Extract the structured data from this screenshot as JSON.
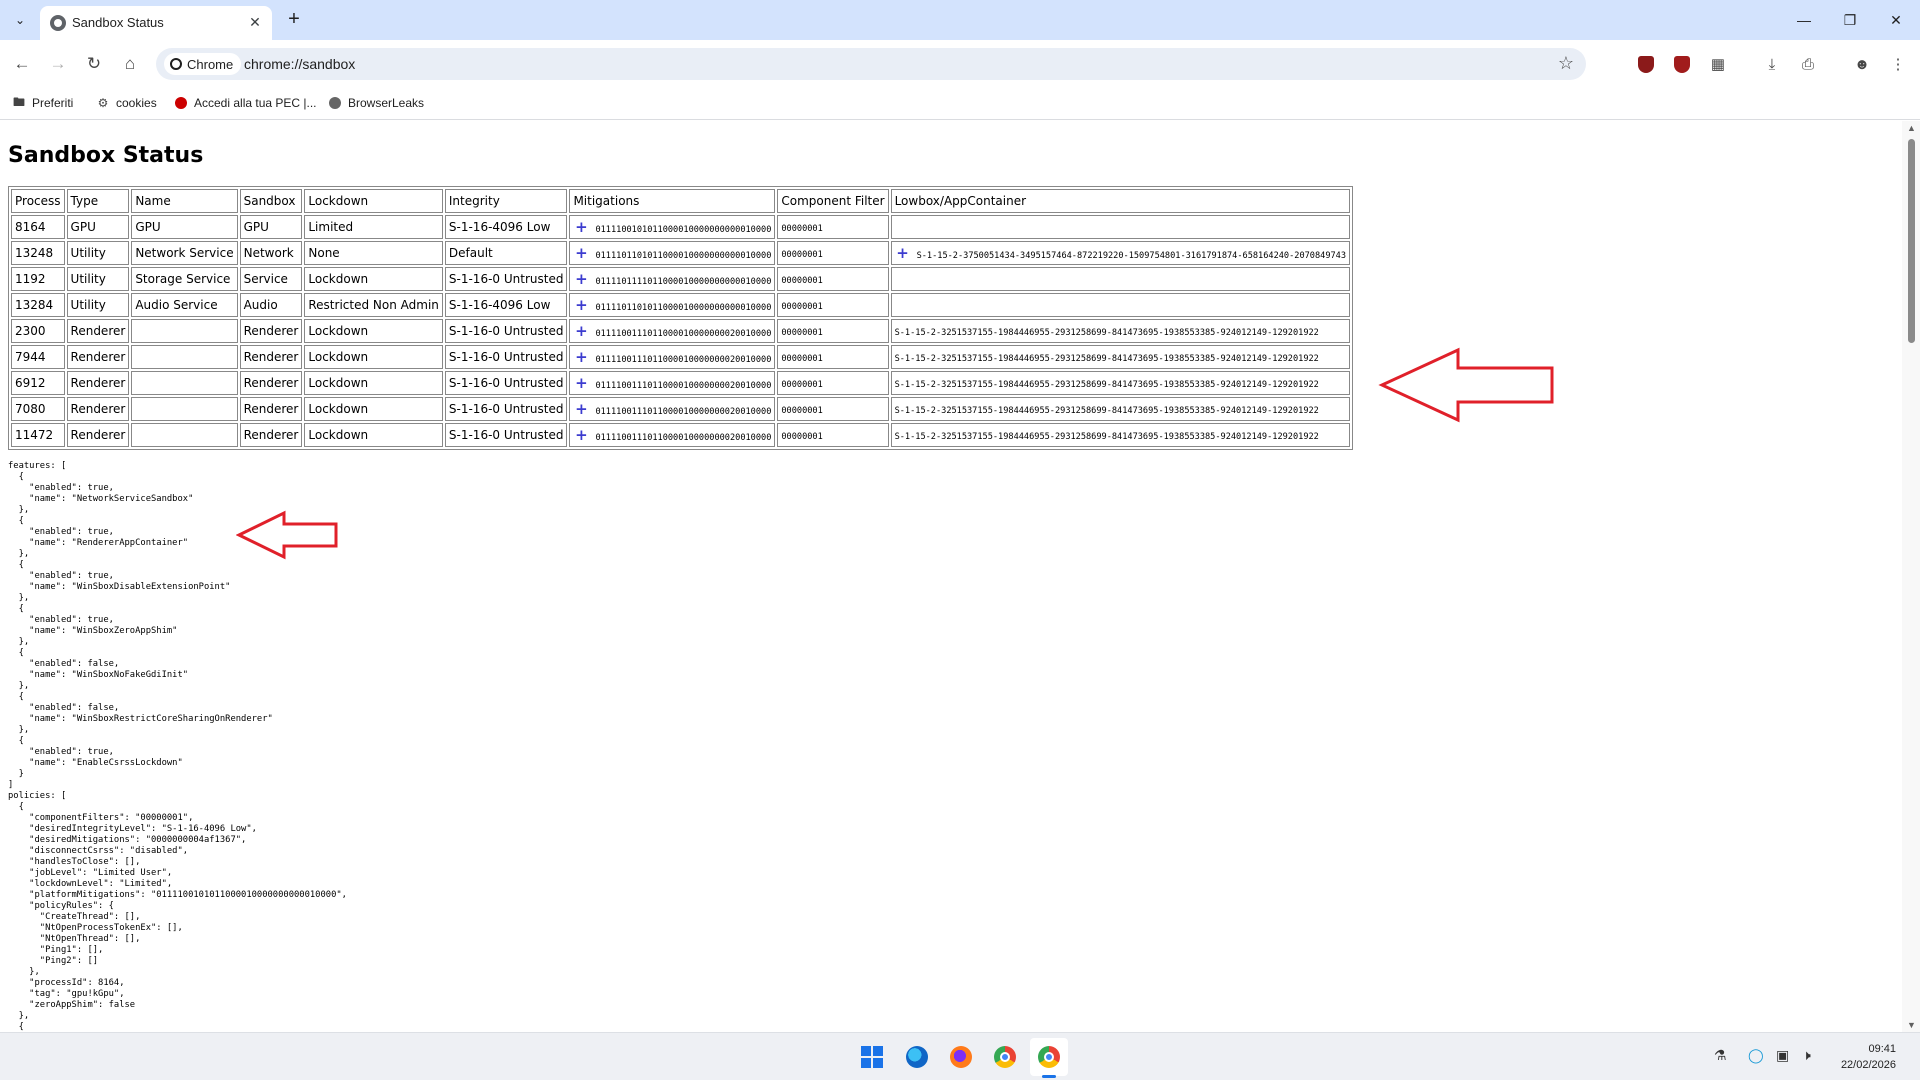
{
  "browser": {
    "tab_title": "Sandbox Status",
    "omnibox_chip": "Chrome",
    "url": "chrome://sandbox",
    "bookmarks": [
      "Preferiti",
      "cookies",
      "Accedi alla tua PEC |...",
      "BrowserLeaks"
    ]
  },
  "page": {
    "title": "Sandbox Status",
    "table": {
      "headers": [
        "Process",
        "Type",
        "Name",
        "Sandbox",
        "Lockdown",
        "Integrity",
        "Mitigations",
        "Component Filter",
        "Lowbox/AppContainer"
      ],
      "rows": [
        [
          "8164",
          "GPU",
          "GPU",
          "GPU",
          "Limited",
          "S-1-16-4096 Low",
          "0111100101011000010000000000010000",
          "00000001",
          ""
        ],
        [
          "13248",
          "Utility",
          "Network Service",
          "Network",
          "None",
          "Default",
          "0111101101011000010000000000010000",
          "00000001",
          "S-1-15-2-3750051434-3495157464-872219220-1509754801-3161791874-658164240-2070849743"
        ],
        [
          "1192",
          "Utility",
          "Storage Service",
          "Service",
          "Lockdown",
          "S-1-16-0 Untrusted",
          "0111101111011000010000000000010000",
          "00000001",
          ""
        ],
        [
          "13284",
          "Utility",
          "Audio Service",
          "Audio",
          "Restricted Non Admin",
          "S-1-16-4096 Low",
          "0111101101011000010000000000010000",
          "00000001",
          ""
        ],
        [
          "2300",
          "Renderer",
          "",
          "Renderer",
          "Lockdown",
          "S-1-16-0 Untrusted",
          "0111100111011000010000000020010000",
          "00000001",
          "S-1-15-2-3251537155-1984446955-2931258699-841473695-1938553385-924012149-129201922"
        ],
        [
          "7944",
          "Renderer",
          "",
          "Renderer",
          "Lockdown",
          "S-1-16-0 Untrusted",
          "0111100111011000010000000020010000",
          "00000001",
          "S-1-15-2-3251537155-1984446955-2931258699-841473695-1938553385-924012149-129201922"
        ],
        [
          "6912",
          "Renderer",
          "",
          "Renderer",
          "Lockdown",
          "S-1-16-0 Untrusted",
          "0111100111011000010000000020010000",
          "00000001",
          "S-1-15-2-3251537155-1984446955-2931258699-841473695-1938553385-924012149-129201922"
        ],
        [
          "7080",
          "Renderer",
          "",
          "Renderer",
          "Lockdown",
          "S-1-16-0 Untrusted",
          "0111100111011000010000000020010000",
          "00000001",
          "S-1-15-2-3251537155-1984446955-2931258699-841473695-1938553385-924012149-129201922"
        ],
        [
          "11472",
          "Renderer",
          "",
          "Renderer",
          "Lockdown",
          "S-1-16-0 Untrusted",
          "0111100111011000010000000020010000",
          "00000001",
          "S-1-15-2-3251537155-1984446955-2931258699-841473695-1938553385-924012149-129201922"
        ]
      ],
      "lowbox_has_expand": [
        false,
        true,
        false,
        false,
        false,
        false,
        false,
        false,
        false
      ]
    },
    "json_dump": "features: [\n  {\n    \"enabled\": true,\n    \"name\": \"NetworkServiceSandbox\"\n  },\n  {\n    \"enabled\": true,\n    \"name\": \"RendererAppContainer\"\n  },\n  {\n    \"enabled\": true,\n    \"name\": \"WinSboxDisableExtensionPoint\"\n  },\n  {\n    \"enabled\": true,\n    \"name\": \"WinSboxZeroAppShim\"\n  },\n  {\n    \"enabled\": false,\n    \"name\": \"WinSboxNoFakeGdiInit\"\n  },\n  {\n    \"enabled\": false,\n    \"name\": \"WinSboxRestrictCoreSharingOnRenderer\"\n  },\n  {\n    \"enabled\": true,\n    \"name\": \"EnableCsrssLockdown\"\n  }\n]\npolicies: [\n  {\n    \"componentFilters\": \"00000001\",\n    \"desiredIntegrityLevel\": \"S-1-16-4096 Low\",\n    \"desiredMitigations\": \"0000000004af1367\",\n    \"disconnectCsrss\": \"disabled\",\n    \"handlesToClose\": [],\n    \"jobLevel\": \"Limited User\",\n    \"lockdownLevel\": \"Limited\",\n    \"platformMitigations\": \"0111100101011000010000000000010000\",\n    \"policyRules\": {\n      \"CreateThread\": [],\n      \"NtOpenProcessTokenEx\": [],\n      \"NtOpenThread\": [],\n      \"Ping1\": [],\n      \"Ping2\": []\n    },\n    \"processId\": 8164,\n    \"tag\": \"gpu!kGpu\",\n    \"zeroAppShim\": false\n  },\n  {"
  },
  "taskbar": {
    "time": "09:41",
    "date": "22/02/2026"
  },
  "colors": {
    "annotation_arrow": "#e0202a",
    "tabstrip": "#d3e3fd",
    "plus_icon": "#3c3ccf"
  }
}
